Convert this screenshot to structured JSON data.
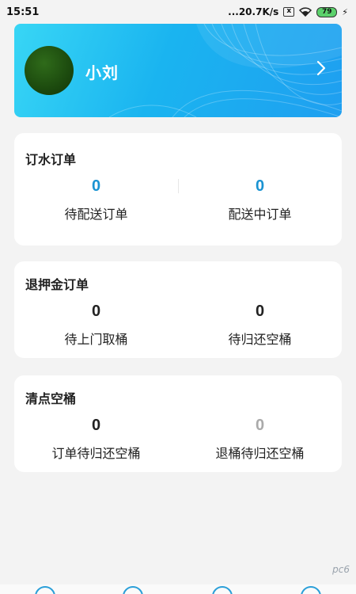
{
  "status_bar": {
    "time": "15:51",
    "network_speed": "...20.7K/s",
    "sim_box": "x",
    "battery": "79"
  },
  "profile": {
    "name": "小刘"
  },
  "sections": [
    {
      "title": "订水订单",
      "stats": [
        {
          "value": "0",
          "label": "待配送订单",
          "color": "#1a93d2"
        },
        {
          "value": "0",
          "label": "配送中订单",
          "color": "#1a93d2"
        }
      ]
    },
    {
      "title": "退押金订单",
      "stats": [
        {
          "value": "0",
          "label": "待上门取桶",
          "color": "#222222"
        },
        {
          "value": "0",
          "label": "待归还空桶",
          "color": "#222222"
        }
      ]
    },
    {
      "title": "清点空桶",
      "stats": [
        {
          "value": "0",
          "label": "订单待归还空桶",
          "color": "#222222"
        },
        {
          "value": "0",
          "label": "退桶待归还空桶",
          "color": "#aaaaaa"
        }
      ]
    }
  ],
  "watermark": "pc6"
}
